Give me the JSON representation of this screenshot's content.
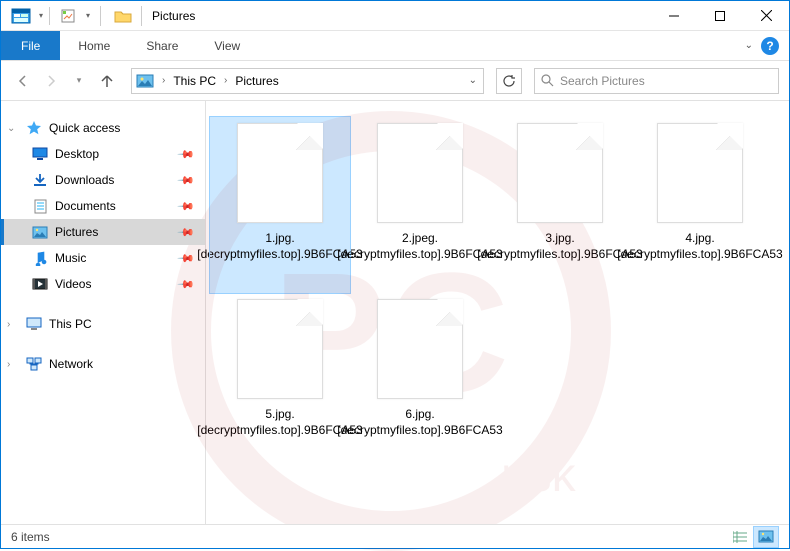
{
  "window": {
    "title": "Pictures",
    "minimize": "—",
    "maximize": "☐",
    "close": "✕"
  },
  "ribbon": {
    "file": "File",
    "tabs": [
      "Home",
      "Share",
      "View"
    ]
  },
  "address": {
    "crumbs": [
      "This PC",
      "Pictures"
    ],
    "search_placeholder": "Search Pictures"
  },
  "nav": {
    "quick_access": "Quick access",
    "items": [
      {
        "label": "Desktop",
        "icon": "desktop",
        "pinned": true
      },
      {
        "label": "Downloads",
        "icon": "downloads",
        "pinned": true
      },
      {
        "label": "Documents",
        "icon": "documents",
        "pinned": true
      },
      {
        "label": "Pictures",
        "icon": "pictures",
        "pinned": true,
        "selected": true
      },
      {
        "label": "Music",
        "icon": "music",
        "pinned": true
      },
      {
        "label": "Videos",
        "icon": "videos",
        "pinned": true
      }
    ],
    "this_pc": "This PC",
    "network": "Network"
  },
  "files": [
    {
      "name": "1.jpg.[decryptmyfiles.top].9B6FCA53",
      "selected": true
    },
    {
      "name": "2.jpeg.[decryptmyfiles.top].9B6FCA53",
      "selected": false
    },
    {
      "name": "3.jpg.[decryptmyfiles.top].9B6FCA53",
      "selected": false
    },
    {
      "name": "4.jpg.[decryptmyfiles.top].9B6FCA53",
      "selected": false
    },
    {
      "name": "5.jpg.[decryptmyfiles.top].9B6FCA53",
      "selected": false
    },
    {
      "name": "6.jpg.[decryptmyfiles.top].9B6FCA53",
      "selected": false
    }
  ],
  "status": {
    "text": "6 items"
  }
}
